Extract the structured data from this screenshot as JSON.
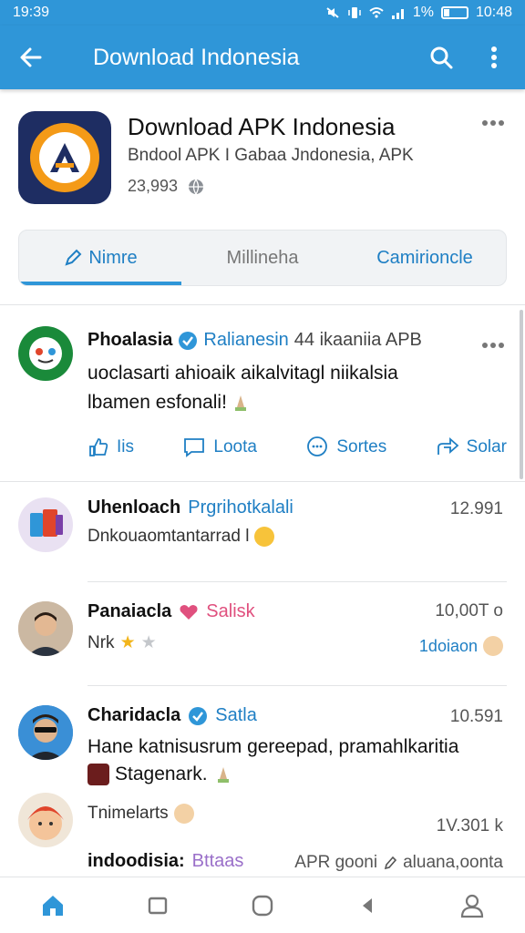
{
  "status_bar": {
    "time": "19:39",
    "battery_pct": "1%",
    "clock_right": "10:48"
  },
  "app_bar": {
    "title": "Download Indonesia"
  },
  "app_info": {
    "name": "Download APK Indonesia",
    "subtitle": "Bndool APK I Gabaa Jndonesia, APK",
    "count": "23,993"
  },
  "tabs": [
    {
      "label": "Nimre",
      "active": true
    },
    {
      "label": "Millineha",
      "active": false
    },
    {
      "label": "Camirioncle",
      "active": false
    }
  ],
  "post": {
    "author": "Phoalasia",
    "tag": "Ralianesin",
    "meta": "44 ikaaniia APB",
    "text_line1": "uoclasarti ahioaik aikalvitagl niikalsia",
    "text_line2": "lbamen esfonali!",
    "actions": {
      "like": "Iis",
      "comment": "Loota",
      "share": "Sortes",
      "send": "Solar"
    }
  },
  "items": [
    {
      "name": "Uhenloach",
      "tag": "Prgrihotkalali",
      "text": "Dnkouaomtantarrad l",
      "count": "12.991"
    },
    {
      "name": "Panaiacla",
      "tag": "Salisk",
      "text": "Nrk",
      "count": "10,00T o",
      "badge": "1doiaon"
    },
    {
      "name": "Charidacla",
      "tag": "Satla",
      "text": "Hane katnisusrum gereepad, pramahlkaritia",
      "text2": "Stagenark.",
      "count": "10.591"
    },
    {
      "name": "Tnimelarts",
      "count": "1V.301 k"
    }
  ],
  "footer_row": {
    "left": "indoodisia:",
    "tag": "Bttaas",
    "right": "APR gooni",
    "right2": "aluana,oonta"
  },
  "colors": {
    "primary": "#2f96d8",
    "accent": "#1f7fc4",
    "heart": "#e0507e"
  }
}
